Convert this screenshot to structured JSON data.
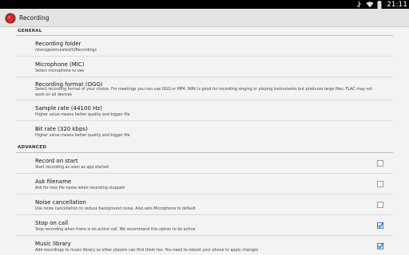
{
  "status_bar": {
    "time": "21:11",
    "icons": [
      "usb-icon",
      "wifi-icon",
      "battery-icon"
    ]
  },
  "action_bar": {
    "title": "Recording",
    "icon": "record-icon",
    "accent": "#cc2222"
  },
  "sections": {
    "general": "GENERAL",
    "advanced": "ADVANCED"
  },
  "prefs": {
    "folder": {
      "title": "Recording folder",
      "summary": "/storage/emulated/0/Recordings"
    },
    "mic": {
      "title": "Microphone (MIC)",
      "summary": "Select microphone to use"
    },
    "format": {
      "title": "Recording format (OGG)",
      "summary": "Select recording format of your choice. For meetings you can use OGG or MP4. WAV is good for recording singing or playing instruments but produces large files. FLAC may not work on all devices"
    },
    "rate": {
      "title": "Sample rate (44100 Hz)",
      "summary": "Higher value means better quality and bigger file"
    },
    "bitrate": {
      "title": "Bit rate (320 kbps)",
      "summary": "Higher value means better quality and bigger file"
    },
    "start": {
      "title": "Record on start",
      "summary": "Start recording as soon as app started",
      "checked": false
    },
    "ask": {
      "title": "Ask filename",
      "summary": "Ask for new file name when recording stopped",
      "checked": false
    },
    "noise": {
      "title": "Noise cancellation",
      "summary": "Use noise cancellation to reduce background noise. Also sets Microphone to default",
      "checked": false
    },
    "call": {
      "title": "Stop on call",
      "summary": "Stop recording when there is an active call. We recommend this option to be active",
      "checked": true
    },
    "music": {
      "title": "Music library",
      "summary": "Add recordings to music library so other players can find them too. You need to reboot your phone to apply changes",
      "checked": true
    }
  }
}
